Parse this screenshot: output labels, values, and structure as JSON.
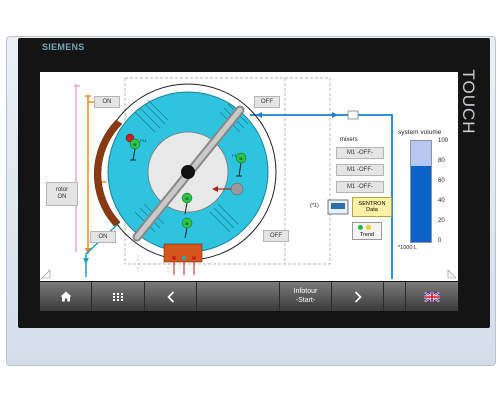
{
  "device": {
    "brand": "SIEMENS",
    "touch_label": "TOUCH"
  },
  "process": {
    "valve_labels": {
      "top_left": "ON",
      "top_right": "OFF",
      "bottom_left": "ON",
      "bottom_right": "OFF"
    },
    "rotor_label": "rotor\nON",
    "mixers_title": "mixers",
    "mixers": [
      "M1 -OFF-",
      "M1 -OFF-",
      "M1 -OFF-"
    ],
    "motor_tags": [
      "M",
      "M",
      "M",
      "M"
    ],
    "tag_small_1": "P11",
    "tag_small_2": "P1",
    "note_marker": "(*1)",
    "sentron_label": "SENTRON\nData",
    "trend_label": "Trend"
  },
  "system_volume": {
    "title": "system volume",
    "ticks": [
      "100",
      "80",
      "60",
      "40",
      "20",
      "0"
    ],
    "unit_label": "*1000 L",
    "level_fraction": 0.75,
    "fill_color": "#0a63c8",
    "empty_color": "#b8c7ef"
  },
  "colors": {
    "tank": "#2ec4e0",
    "pipe_blue": "#1f7fd0",
    "pipe_orange": "#f08a20",
    "pipe_pink": "#f3a6c8"
  },
  "navbar": {
    "home_icon": "home-icon",
    "grid_icon": "grid-icon",
    "back_icon": "chevron-left-icon",
    "infotour_label": "Infotour\n-Start-",
    "next_icon": "chevron-right-icon",
    "language_icon": "uk-flag-icon"
  }
}
